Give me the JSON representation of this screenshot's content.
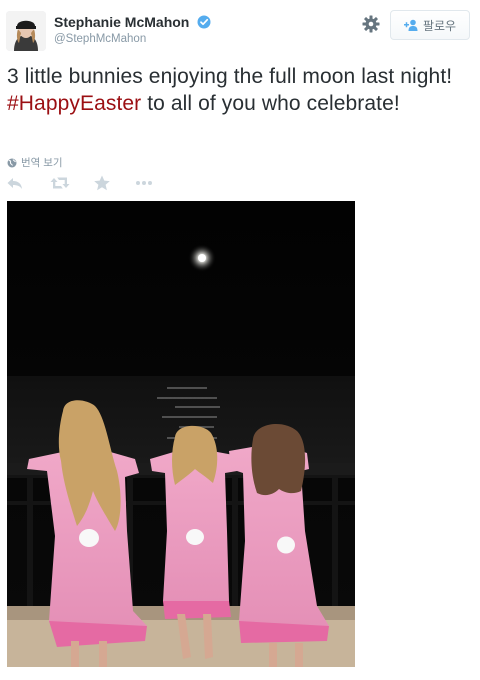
{
  "user": {
    "display_name": "Stephanie McMahon",
    "handle": "@StephMcMahon",
    "verified": true
  },
  "follow_button": {
    "label": "팔로우",
    "icon": "add-user-icon"
  },
  "settings": {
    "icon": "gear-icon"
  },
  "tweet": {
    "text_before": "3 little bunnies enjoying the full moon last night! ",
    "hashtag": "#HappyEaster",
    "text_after": " to all of you who celebrate!"
  },
  "translate": {
    "label": "번역 보기",
    "icon": "globe-icon"
  },
  "actions": [
    {
      "name": "reply",
      "icon": "reply-icon"
    },
    {
      "name": "retweet",
      "icon": "retweet-icon"
    },
    {
      "name": "favorite",
      "icon": "star-icon"
    },
    {
      "name": "more",
      "icon": "more-icon"
    }
  ],
  "colors": {
    "hashtag": "#9b0f13",
    "verified": "#55acee",
    "icon_gray": "#ccd6dd",
    "text": "#292f33",
    "muted": "#8899a6"
  },
  "media": {
    "type": "photo"
  }
}
